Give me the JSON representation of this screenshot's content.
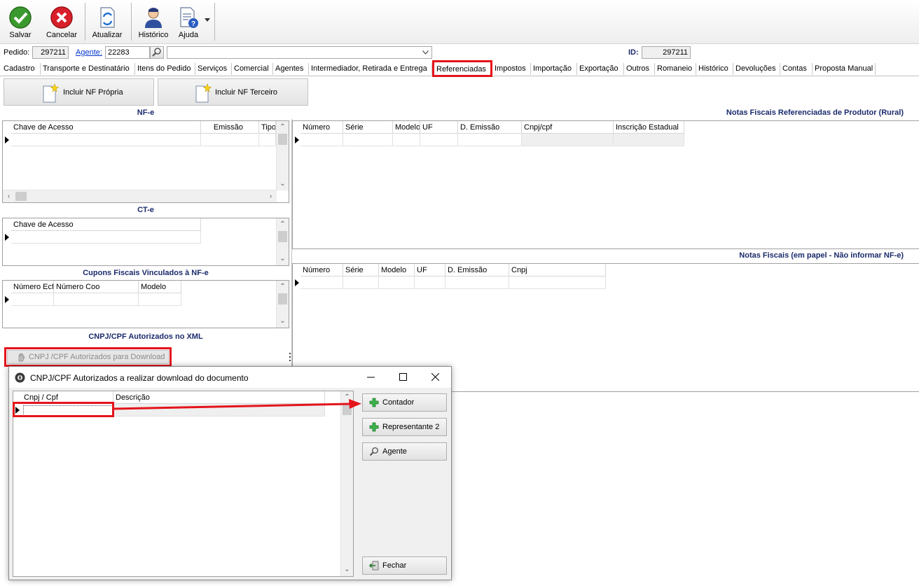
{
  "toolbar": {
    "save": "Salvar",
    "cancel": "Cancelar",
    "refresh": "Atualizar",
    "history": "Histórico",
    "help": "Ajuda"
  },
  "header": {
    "pedido_label": "Pedido:",
    "pedido_value": "297211",
    "agente_label": "Agente:",
    "agente_value": "22283",
    "agente_name": "",
    "id_label": "ID:",
    "id_value": "297211"
  },
  "tabs": [
    "Cadastro",
    "Transporte e Destinatário",
    "Itens do Pedido",
    "Serviços",
    "Comercial",
    "Agentes",
    "Intermediador, Retirada e Entrega",
    "Referenciadas",
    "Impostos",
    "Importação",
    "Exportação",
    "Outros",
    "Romaneio",
    "Histórico",
    "Devoluções",
    "Contas",
    "Proposta Manual"
  ],
  "buttons": {
    "incluir_propria": "Incluir NF Própria",
    "incluir_terceiro": "Incluir NF Terceiro",
    "cnpj_download": "CNPJ /CPF Autorizados para Download"
  },
  "sections": {
    "nfe": {
      "title": "NF-e",
      "columns": [
        "Chave de Acesso",
        "Emissão",
        "Tipo"
      ]
    },
    "cte": {
      "title": "CT-e",
      "columns": [
        "Chave de Acesso"
      ]
    },
    "cupons": {
      "title": "Cupons Fiscais Vinculados à NF-e",
      "columns": [
        "Número Ecf",
        "Número Coo",
        "Modelo"
      ]
    },
    "cnpj_xml": {
      "title": "CNPJ/CPF Autorizados no XML"
    },
    "produtor": {
      "title": "Notas Fiscais Referenciadas de Produtor (Rural)",
      "columns": [
        "Número",
        "Série",
        "Modelo",
        "UF",
        "D. Emissão",
        "Cnpj/cpf",
        "Inscrição Estadual"
      ]
    },
    "papel": {
      "title": "Notas Fiscais (em papel - Não informar NF-e)",
      "columns": [
        "Número",
        "Série",
        "Modelo",
        "UF",
        "D. Emissão",
        "Cnpj"
      ]
    }
  },
  "dialog": {
    "title": "CNPJ/CPF Autorizados a realizar download do documento",
    "columns": [
      "Cnpj / Cpf",
      "Descrição"
    ],
    "buttons": {
      "contador": "Contador",
      "representante": "Representante 2",
      "agente": "Agente",
      "fechar": "Fechar"
    }
  },
  "colors": {
    "highlight": "#e4141b",
    "section_title": "#1a2a6c",
    "link": "#0033cc"
  }
}
